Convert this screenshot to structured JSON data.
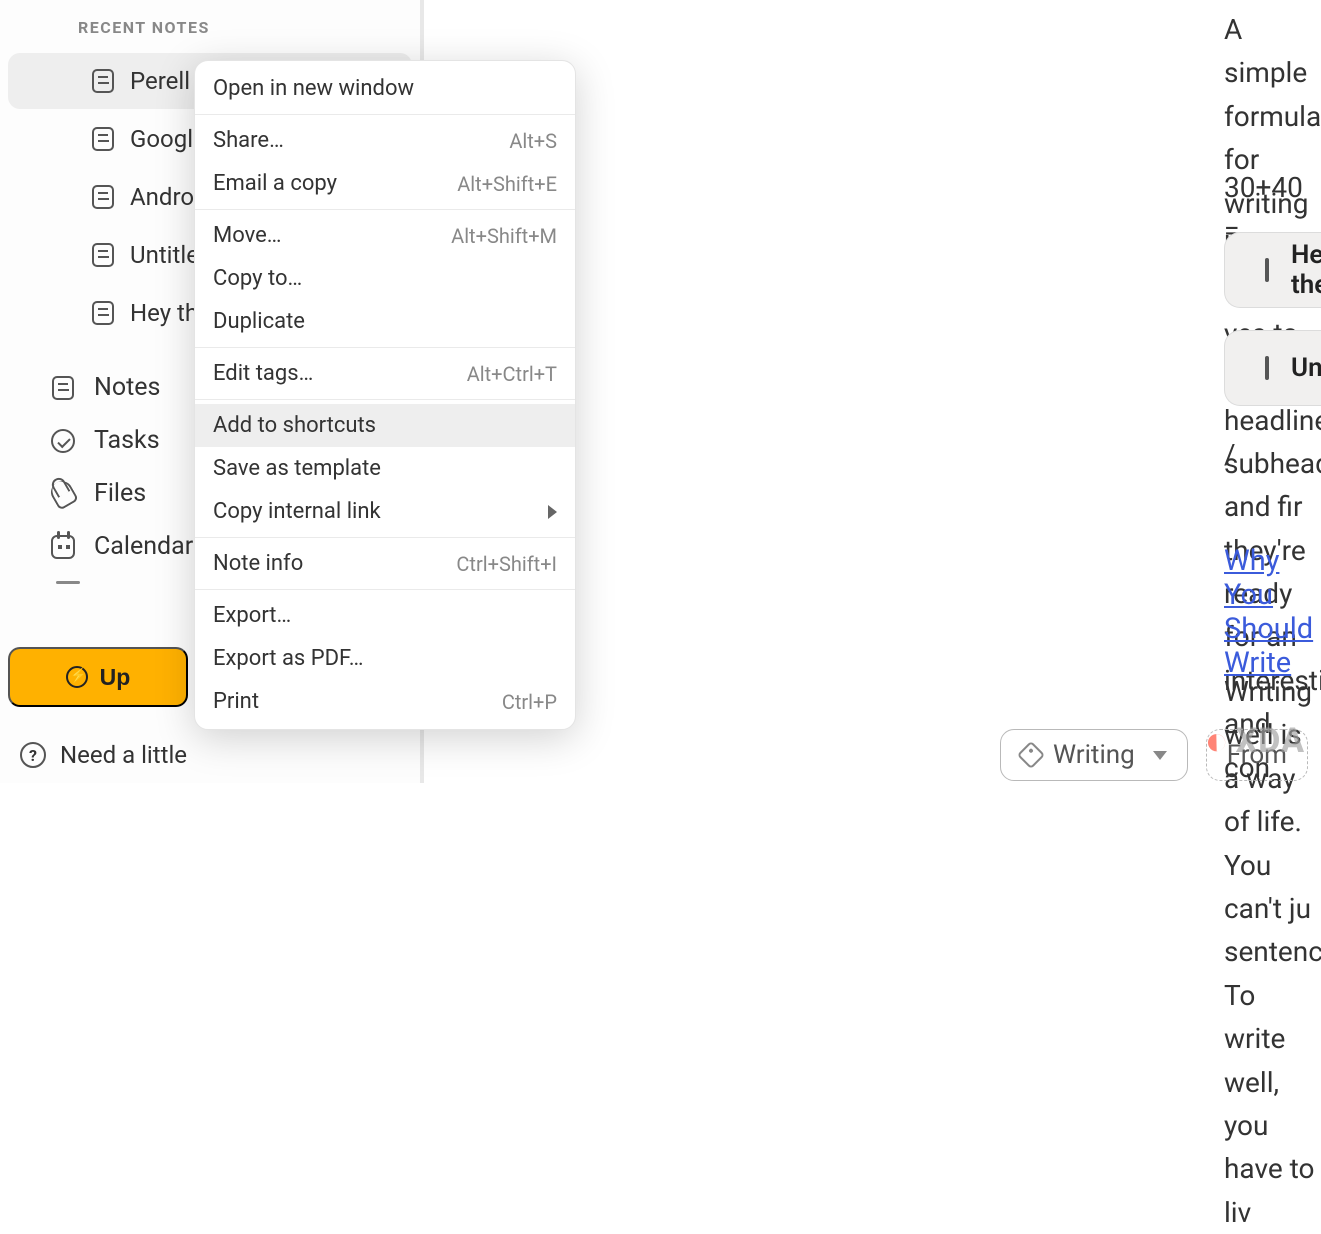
{
  "sidebar": {
    "section_header": "RECENT NOTES",
    "recent": [
      {
        "label": "Perell"
      },
      {
        "label": "Google"
      },
      {
        "label": "Android"
      },
      {
        "label": "Untitled"
      },
      {
        "label": "Hey the"
      }
    ],
    "nav": {
      "notes": "Notes",
      "tasks": "Tasks",
      "files": "Files",
      "calendar": "Calendar"
    },
    "upgrade_label": "Up",
    "help_label": "Need a little"
  },
  "context_menu": {
    "open_new_window": "Open in new window",
    "share": "Share…",
    "share_shortcut": "Alt+S",
    "email_copy": "Email a copy",
    "email_copy_shortcut": "Alt+Shift+E",
    "move": "Move…",
    "move_shortcut": "Alt+Shift+M",
    "copy_to": "Copy to…",
    "duplicate": "Duplicate",
    "edit_tags": "Edit tags…",
    "edit_tags_shortcut": "Alt+Ctrl+T",
    "add_shortcuts": "Add to shortcuts",
    "save_template": "Save as template",
    "copy_internal_link": "Copy internal link",
    "note_info": "Note info",
    "note_info_shortcut": "Ctrl+Shift+I",
    "export": "Export…",
    "export_pdf": "Export as PDF…",
    "print": "Print",
    "print_shortcut": "Ctrl+P"
  },
  "content": {
    "p1": "A simple formula for writing hooks: \"Get yes to the headline, subheading, and fir they're ready for an interesting and con",
    "p2": "30+40 =",
    "card1": "Hey there",
    "card2": "Untitled",
    "slash": "/",
    "link": "Why You Should Write",
    "p3": "Writing well is a way of life. You can't ju sentences. To write well, you have to liv"
  },
  "tags": {
    "tag1": "Writing",
    "tag2": "From"
  },
  "watermark": "XDA"
}
